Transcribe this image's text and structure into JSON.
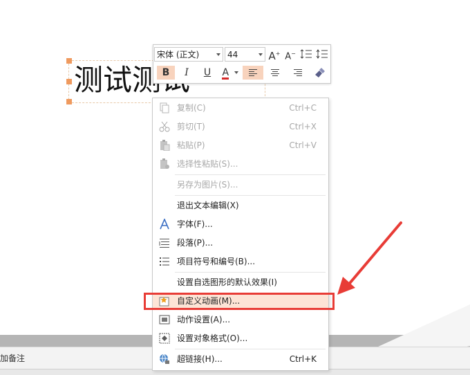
{
  "slide": {
    "text": "测试测试"
  },
  "toolbar": {
    "font_name": "宋体 (正文)",
    "font_size": "44",
    "grow_font": "A",
    "shrink_font": "A",
    "bold": "B",
    "italic": "I",
    "underline": "U",
    "font_color": "A",
    "font_color_value": "#d62a2a"
  },
  "menu": {
    "copy": {
      "label": "复制(C)",
      "shortcut": "Ctrl+C"
    },
    "cut": {
      "label": "剪切(T)",
      "shortcut": "Ctrl+X"
    },
    "paste": {
      "label": "粘贴(P)",
      "shortcut": "Ctrl+V"
    },
    "paste_special": {
      "label": "选择性粘贴(S)..."
    },
    "save_as_image": {
      "label": "另存为图片(S)..."
    },
    "exit_edit": {
      "label": "退出文本编辑(X)"
    },
    "font": {
      "label": "字体(F)..."
    },
    "paragraph": {
      "label": "段落(P)..."
    },
    "bullets": {
      "label": "项目符号和编号(B)..."
    },
    "default_shape": {
      "label": "设置自选图形的默认效果(I)"
    },
    "custom_animation": {
      "label": "自定义动画(M)..."
    },
    "action_settings": {
      "label": "动作设置(A)..."
    },
    "format_object": {
      "label": "设置对象格式(O)..."
    },
    "hyperlink": {
      "label": "超链接(H)...",
      "shortcut": "Ctrl+K"
    }
  },
  "notes": {
    "label": "加备注"
  },
  "colors": {
    "accent": "#e83c36",
    "highlight": "#fde4d6",
    "handle": "#ef9a5e"
  }
}
